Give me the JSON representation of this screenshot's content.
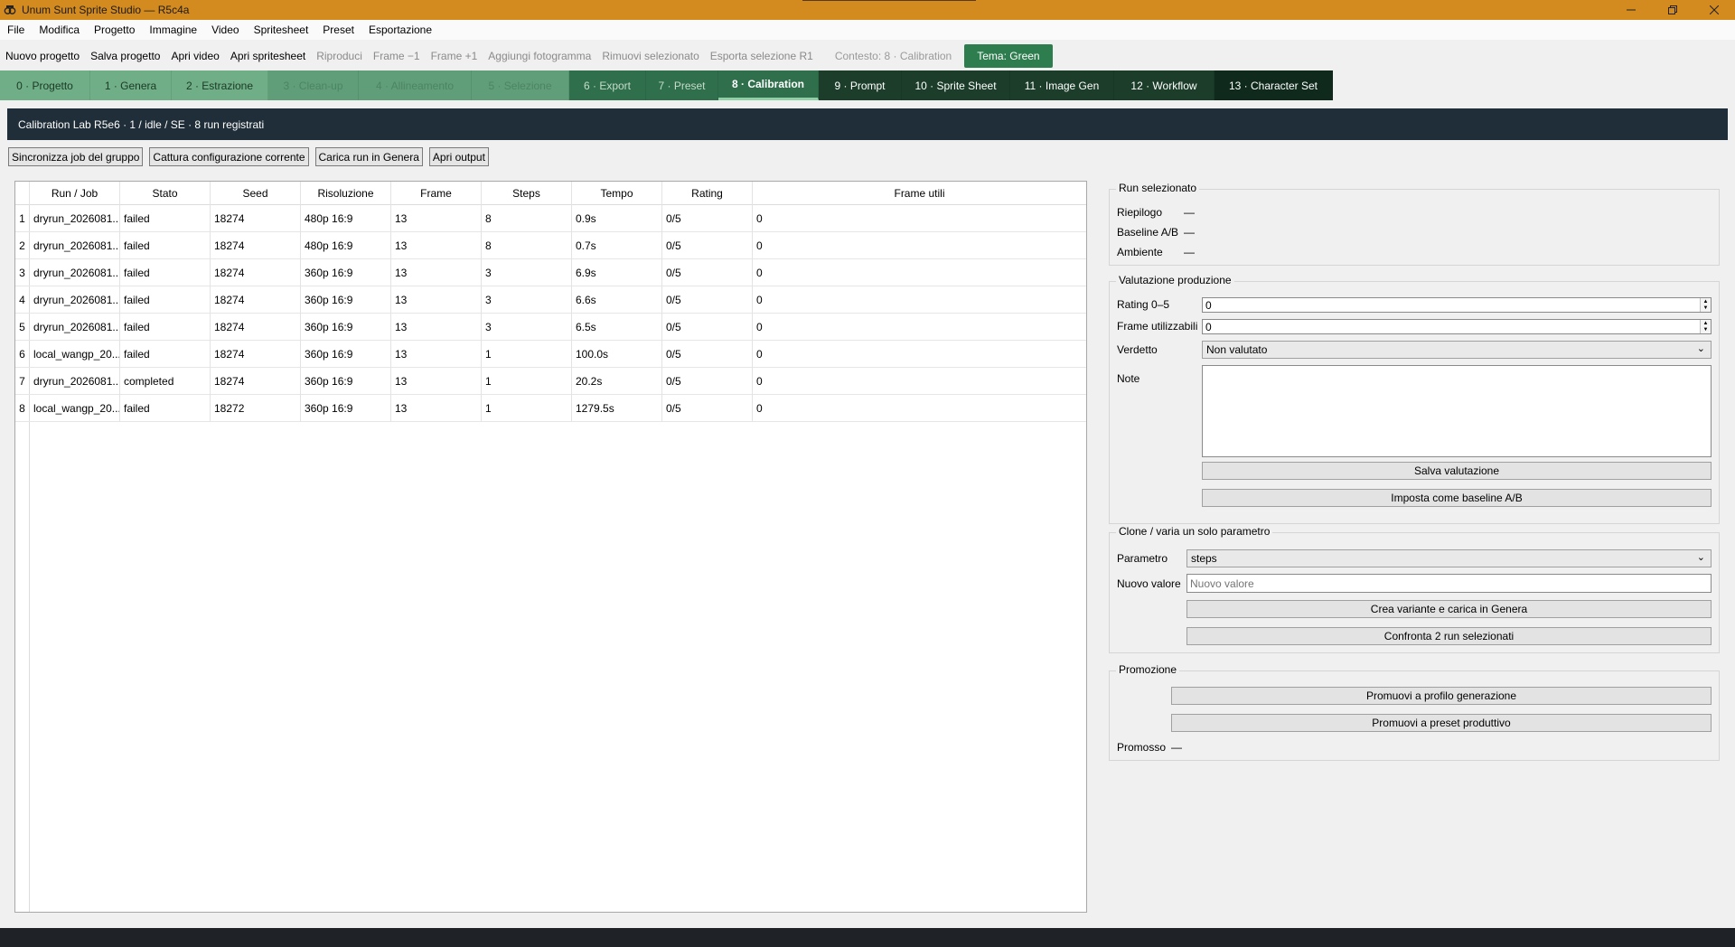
{
  "window": {
    "title": "Unum Sunt Sprite Studio — R5c4a",
    "controls": [
      "minimize-icon",
      "restore-icon",
      "close-icon"
    ]
  },
  "menu": [
    "File",
    "Modifica",
    "Progetto",
    "Immagine",
    "Video",
    "Spritesheet",
    "Preset",
    "Esportazione"
  ],
  "toolbar": {
    "items": [
      "Nuovo progetto",
      "Salva progetto",
      "Apri video",
      "Apri spritesheet",
      "Riproduci",
      "Frame −1",
      "Frame +1",
      "Aggiungi fotogramma",
      "Rimuovi selezionato",
      "Esporta selezione R1"
    ],
    "context": "Contesto: 8 · Calibration",
    "theme": "Tema: Green"
  },
  "tabs": [
    "0 · Progetto",
    "1 · Genera",
    "2 · Estrazione",
    "3 · Clean-up",
    "4 · Allineamento",
    "5 · Selezione",
    "6 · Export",
    "7 · Preset",
    "8 · Calibration",
    "9 · Prompt",
    "10 · Sprite Sheet",
    "11 · Image Gen",
    "12 · Workflow",
    "13 · Character Set"
  ],
  "active_tab": "8 · Calibration",
  "status": "Calibration Lab R5e6 · 1 / idle / SE · 8 run registrati",
  "actions": [
    "Sincronizza job del gruppo",
    "Cattura configurazione corrente",
    "Carica run in Genera",
    "Apri output"
  ],
  "table": {
    "columns": [
      "Run / Job",
      "Stato",
      "Seed",
      "Risoluzione",
      "Frame",
      "Steps",
      "Tempo",
      "Rating",
      "Frame utili"
    ],
    "rows": [
      {
        "n": "1",
        "cells": [
          "dryrun_2026081...",
          "failed",
          "18274",
          "480p 16:9",
          "13",
          "8",
          "0.9s",
          "0/5",
          "0"
        ]
      },
      {
        "n": "2",
        "cells": [
          "dryrun_2026081...",
          "failed",
          "18274",
          "480p 16:9",
          "13",
          "8",
          "0.7s",
          "0/5",
          "0"
        ]
      },
      {
        "n": "3",
        "cells": [
          "dryrun_2026081...",
          "failed",
          "18274",
          "360p 16:9",
          "13",
          "3",
          "6.9s",
          "0/5",
          "0"
        ]
      },
      {
        "n": "4",
        "cells": [
          "dryrun_2026081...",
          "failed",
          "18274",
          "360p 16:9",
          "13",
          "3",
          "6.6s",
          "0/5",
          "0"
        ]
      },
      {
        "n": "5",
        "cells": [
          "dryrun_2026081...",
          "failed",
          "18274",
          "360p 16:9",
          "13",
          "3",
          "6.5s",
          "0/5",
          "0"
        ]
      },
      {
        "n": "6",
        "cells": [
          "local_wangp_20...",
          "failed",
          "18274",
          "360p 16:9",
          "13",
          "1",
          "100.0s",
          "0/5",
          "0"
        ]
      },
      {
        "n": "7",
        "cells": [
          "dryrun_2026081...",
          "completed",
          "18274",
          "360p 16:9",
          "13",
          "1",
          "20.2s",
          "0/5",
          "0"
        ]
      },
      {
        "n": "8",
        "cells": [
          "local_wangp_20...",
          "failed",
          "18272",
          "360p 16:9",
          "13",
          "1",
          "1279.5s",
          "0/5",
          "0"
        ]
      }
    ]
  },
  "selected_run": {
    "title": "Run selezionato",
    "riepilogo_label": "Riepilogo",
    "riepilogo_value": "—",
    "baseline_label": "Baseline A/B",
    "baseline_value": "—",
    "ambiente_label": "Ambiente",
    "ambiente_value": "—"
  },
  "evaluation": {
    "title": "Valutazione produzione",
    "rating_label": "Rating 0–5",
    "rating_value": "0",
    "frames_label": "Frame utilizzabili",
    "frames_value": "0",
    "verdict_label": "Verdetto",
    "verdict_value": "Non valutato",
    "notes_label": "Note",
    "save_label": "Salva valutazione",
    "baseline_label": "Imposta come baseline A/B"
  },
  "clone": {
    "title": "Clone / varia un solo parametro",
    "param_label": "Parametro",
    "param_value": "steps",
    "new_value_label": "Nuovo valore",
    "new_value_placeholder": "Nuovo valore",
    "create_label": "Crea variante e carica in Genera",
    "compare_label": "Confronta 2 run selezionati"
  },
  "promotion": {
    "title": "Promozione",
    "profile_label": "Promuovi a profilo generazione",
    "preset_label": "Promuovi a preset produttivo",
    "promoted_label": "Promosso",
    "promoted_value": "—"
  }
}
